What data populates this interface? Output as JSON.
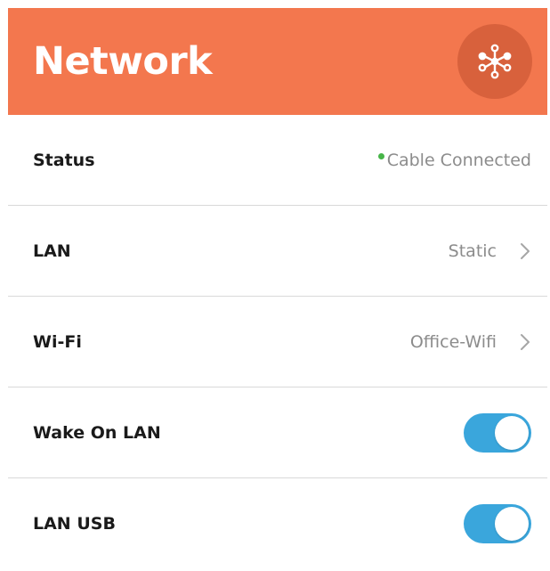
{
  "header": {
    "title": "Network",
    "icon": "network-nodes-icon",
    "color": "#f3774e",
    "badge_color": "#d8613c"
  },
  "rows": {
    "status": {
      "label": "Status",
      "value": "Cable Connected",
      "indicator_color": "#47b548"
    },
    "lan": {
      "label": "LAN",
      "value": "Static"
    },
    "wifi": {
      "label": "Wi-Fi",
      "value": "Office-Wifi"
    },
    "wake_on_lan": {
      "label": "Wake On LAN",
      "enabled": true
    },
    "lan_usb": {
      "label": "LAN USB",
      "enabled": true
    }
  },
  "colors": {
    "toggle_on": "#3aa6dc",
    "divider": "#d9d9d9",
    "value_text": "#8c8c8c"
  }
}
